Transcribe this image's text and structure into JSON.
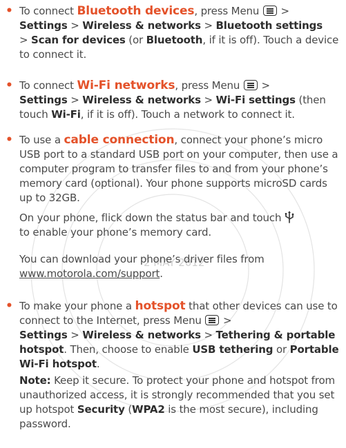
{
  "watermark": {
    "date_stamp": "2 MAY 2012",
    "color": "#d9d9d9"
  },
  "colors": {
    "keyword": "#e4522a",
    "body_text": "#4a4a4a",
    "bold_text": "#2e2e2e"
  },
  "bluetooth": {
    "t1": "To connect ",
    "kw": "Bluetooth devices",
    "t2": ", press Menu ",
    "t3": " >",
    "b1": "Settings",
    "t4": " > ",
    "b2": "Wireless & networks",
    "t5": " > ",
    "b3": "Bluetooth settings",
    "t6": "> ",
    "b4": "Scan for devices",
    "t7": " (or ",
    "b5": "Bluetooth",
    "t8": ", if it is off). Touch a device to connect it."
  },
  "wifi": {
    "t1": "To connect ",
    "kw": "Wi-Fi networks",
    "t2": ", press Menu ",
    "t3": " >",
    "b1": "Settings",
    "t4": " > ",
    "b2": "Wireless & networks",
    "t5": " > ",
    "b3": "Wi-Fi settings",
    "t6": " (then touch ",
    "b4": "Wi-Fi",
    "t7": ", if it is off). Touch a network to connect it."
  },
  "cable": {
    "t1": "To use a ",
    "kw": "cable connection",
    "t2": ", connect your phone’s micro USB port to a standard USB port on your computer, then use a computer program to transfer files to and from your phone’s memory card (optional). Your phone supports microSD cards up to 32GB.",
    "p2_t1": "On your phone, flick down the status bar and touch ",
    "p2_t2": "to enable your phone’s memory card.",
    "p3_t1": "You can download your phone’s driver files from ",
    "p3_link": "www.motorola.com/support",
    "p3_t2": "."
  },
  "hotspot": {
    "t1": "To make your phone a ",
    "kw": "hotspot",
    "t2": " that other devices can use to connect to the Internet, press Menu ",
    "t3": " >",
    "b1": "Settings",
    "t4": " > ",
    "b2": "Wireless & networks",
    "t5": " > ",
    "b3": "Tethering & portable hotspot",
    "t6": ". Then, choose to enable ",
    "b4": "USB tethering",
    "t7": " or ",
    "b5": "Portable Wi-Fi hotspot",
    "t8": ".",
    "note_label": "Note:",
    "note_t1": " Keep it secure. To protect your phone and hotspot from unauthorized access, it is strongly recommended that you set up hotspot ",
    "note_b1": "Security",
    "note_t2": " (",
    "note_b2": "WPA2",
    "note_t3": " is the most secure), including password."
  }
}
